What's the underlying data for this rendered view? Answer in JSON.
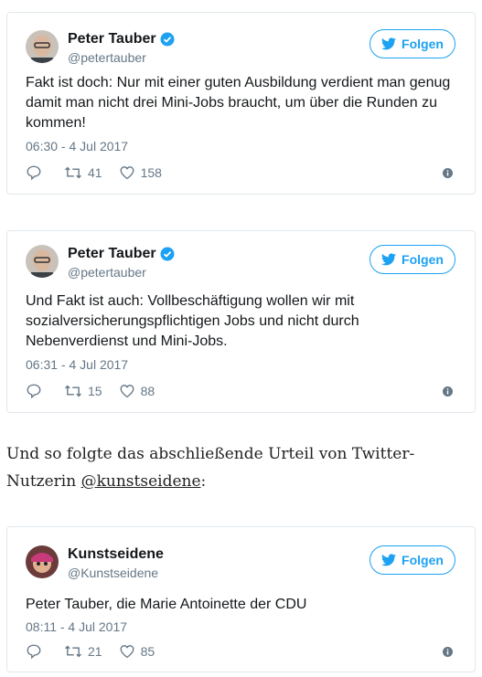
{
  "follow_label": "Folgen",
  "tweets": [
    {
      "author": "Peter Tauber",
      "handle": "@petertauber",
      "text": "Fakt ist doch: Nur mit einer guten Ausbildung verdient man genug damit man nicht drei Mini-Jobs braucht, um über die Runden zu kommen!",
      "time": "06:30 - 4 Jul 2017",
      "retweets": "41",
      "likes": "158",
      "verified": true
    },
    {
      "author": "Peter Tauber",
      "handle": "@petertauber",
      "text": "Und Fakt ist auch: Vollbeschäftigung wollen wir mit sozialversicherungspflichtigen Jobs und nicht durch Nebenverdienst und Mini-Jobs.",
      "time": "06:31 - 4 Jul 2017",
      "retweets": "15",
      "likes": "88",
      "verified": true
    },
    {
      "author": "Kunstseidene",
      "handle": "@Kunstseidene",
      "text": "Peter Tauber, die Marie Antoinette der CDU",
      "time": "08:11 - 4 Jul 2017",
      "retweets": "21",
      "likes": "85",
      "verified": false
    }
  ],
  "prose": {
    "text": "Und so folgte das abschließende Urteil von Twitter-Nutzerin",
    "link": "@kunstseidene",
    "suffix": ":"
  },
  "colors": {
    "accent": "#1da1f2",
    "muted": "#657786",
    "border": "#e1e8ed"
  }
}
